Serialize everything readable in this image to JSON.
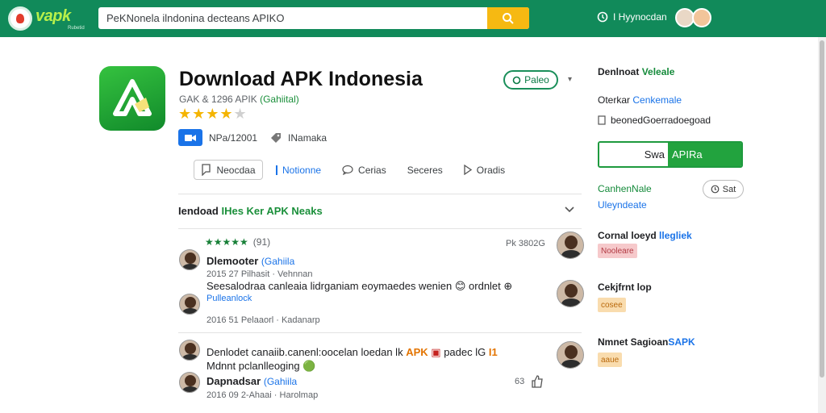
{
  "header": {
    "logo_text": "vapk",
    "logo_sub": "Rubetid",
    "search_value": "PeKNonela ilndonina decteans APIKO",
    "user_label": "I Hyynocdan",
    "colors": {
      "brand": "#118a5a",
      "accent": "#f6b912"
    }
  },
  "app": {
    "title": "Download APK Indonesia",
    "meta_prefix": "GAK & 1296 APIK",
    "meta_tag": "(Gahiital)",
    "rating": 4,
    "rating_max": 5,
    "badge_text": "NPa/12001",
    "badge_text2": "INamaka",
    "follow_label": "Paleo"
  },
  "tabs": [
    {
      "label": "Neocdaa",
      "icon": "comment-icon",
      "active": false,
      "boxed": true
    },
    {
      "label": "Notionne",
      "icon": "bar-icon",
      "active": true,
      "boxed": false
    },
    {
      "label": "Cerias",
      "icon": "chat-icon",
      "active": false,
      "boxed": false
    },
    {
      "label": "Seceres",
      "icon": "",
      "active": false,
      "boxed": false
    },
    {
      "label": "Oradis",
      "icon": "play-icon",
      "active": false,
      "boxed": false
    }
  ],
  "section": {
    "title_prefix": "Iendoad",
    "title_highlight": "IHes Ker APK",
    "title_suffix": "Neaks"
  },
  "reviews": {
    "rating_stars": "★★★★★",
    "rating_count": "(91)",
    "top_right": "Pk 3802G",
    "items": [
      {
        "name": "Dlemooter",
        "tag": "(Gahiila",
        "date": "2015 27 Pilhasit · Vehnnan"
      },
      {
        "text": "Seesalodraa canleaia lidrganiam eoymaedes wenien 😊 ordnlet ⊕",
        "link": "Pulleanlock",
        "date": "2016 51 Pelaaorl · Kadanarp"
      },
      {
        "text_a": "Denlodet canaiib.canenl:oocelan loedan lk",
        "text_b": "APK",
        "text_c": "padec lG",
        "text_d": "I1",
        "line2": "Mdnnt pclanlleoging 🟢",
        "name": "Dapnadsar",
        "tag": "(Gahiila",
        "date": "2016 09 2-Ahaai · Harolmap",
        "likes": "63"
      }
    ]
  },
  "sidebar": {
    "item1_a": "Denlnoat",
    "item1_b": "Veleale",
    "item2_a": "Oterkar",
    "item2_b": "Cenkemale",
    "item3": "beonedGoerradoegoad",
    "download_left": "Swa",
    "download_right": "APIRa",
    "item4_a": "Canhen",
    "item4_b": "Nale",
    "item4_line2": "Uleyndeate",
    "sat_label": "Sat",
    "item5_a": "Cornal",
    "item5_b": "loeyd",
    "item5_c": "llegliek",
    "pill1": "Nooleare",
    "item6": "Cekjfrnt lop",
    "pill2": "cosee",
    "item7_a": "Nmnet Sagioan",
    "item7_b": "SAPK",
    "pill3": "aaue"
  }
}
